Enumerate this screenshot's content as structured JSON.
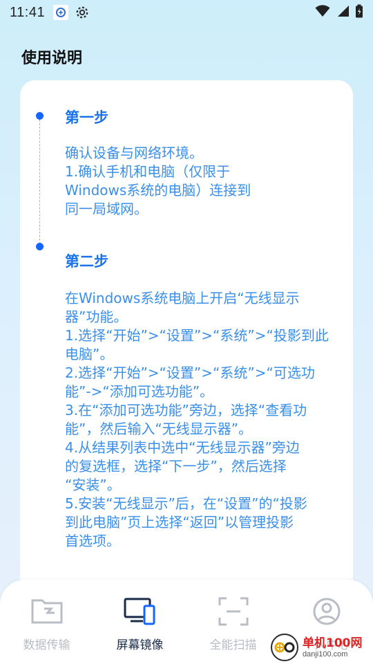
{
  "status_bar": {
    "time": "11:41"
  },
  "page": {
    "title": "使用说明"
  },
  "steps": [
    {
      "title": "第一步",
      "body": "确认设备与网络环境。\n1.确认手机和电脑（仅限于\nWindows系统的电脑）连接到\n同一局域网。"
    },
    {
      "title": "第二步",
      "body": "在Windows系统电脑上开启“无线显示\n器”功能。\n1.选择“开始”>“设置”>“系统”>“投影到此\n电脑”。\n2.选择“开始”>“设置”>“系统”>“可选功\n能”->“添加可选功能”。\n3.在“添加可选功能”旁边，选择“查看功\n能”，然后输入“无线显示器”。\n4.从结果列表中选中“无线显示器”旁边\n的复选框，选择“下一步”，然后选择\n“安装”。\n5.安装“无线显示”后，在“设置”的“投影\n到此电脑”页上选择“返回”以管理投影\n首选项。"
    }
  ],
  "bottom_nav": {
    "items": [
      {
        "label": "数据传输",
        "icon": "folder-transfer-icon",
        "active": false
      },
      {
        "label": "屏幕镜像",
        "icon": "screen-mirror-icon",
        "active": true
      },
      {
        "label": "全能扫描",
        "icon": "scan-frame-icon",
        "active": false
      },
      {
        "label": "个人中心",
        "icon": "user-profile-icon",
        "active": false
      }
    ]
  },
  "watermark": {
    "name": "单机100网",
    "domain": "danji100.com"
  },
  "colors": {
    "accent": "#1565ff",
    "step_title": "#1a73e8",
    "step_body": "#3a8fe8",
    "nav_inactive": "#b8bcc4",
    "nav_active": "#1a2b4a"
  }
}
